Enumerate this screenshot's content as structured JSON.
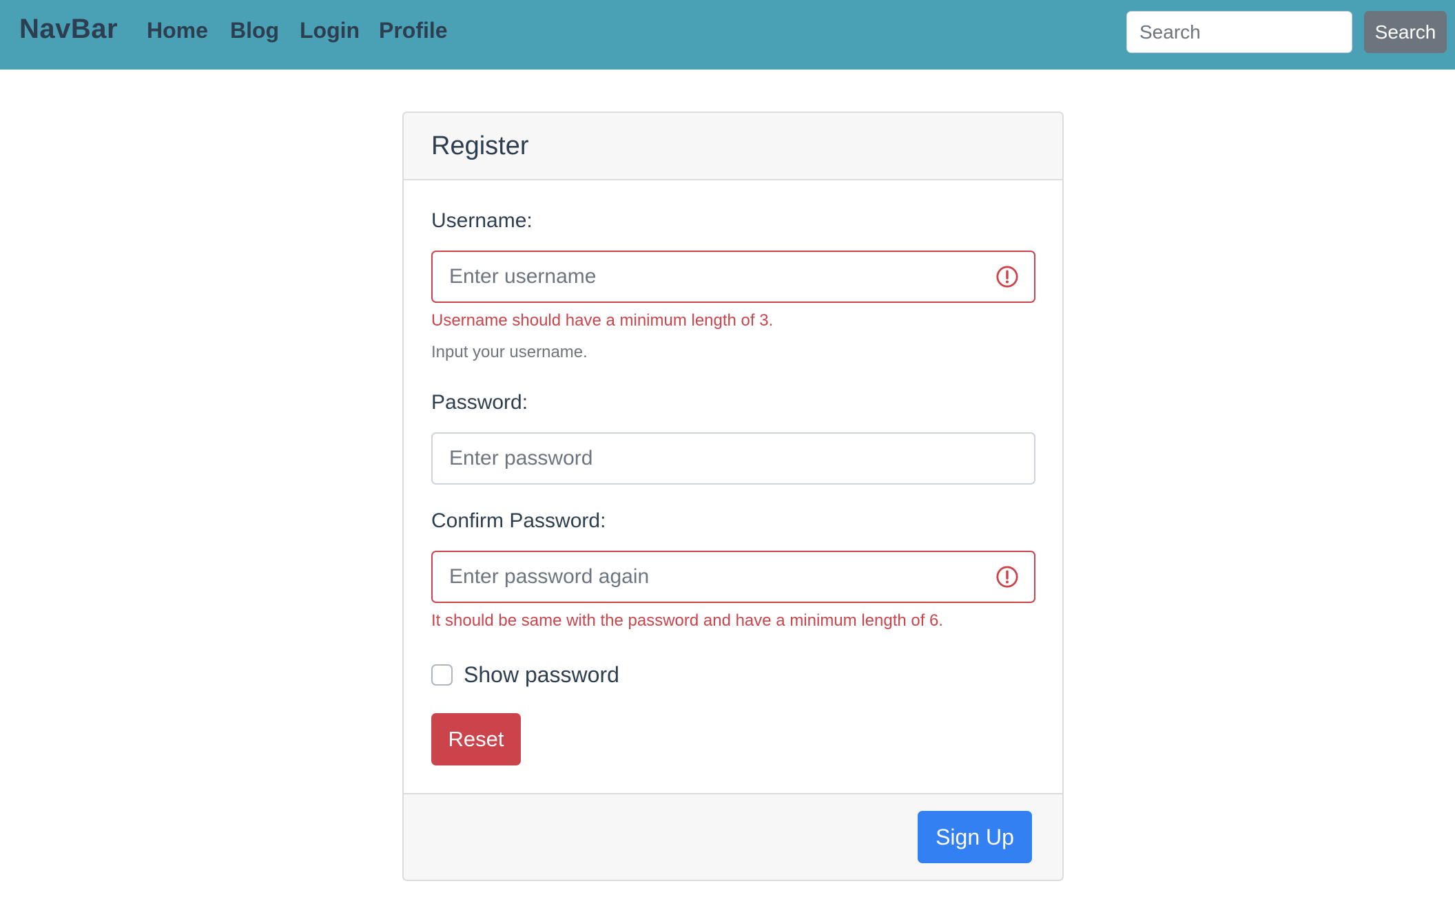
{
  "navbar": {
    "brand": "NavBar",
    "links": [
      {
        "label": "Home"
      },
      {
        "label": "Blog"
      },
      {
        "label": "Login"
      },
      {
        "label": "Profile"
      }
    ],
    "search": {
      "placeholder": "Search",
      "value": "",
      "button_label": "Search"
    }
  },
  "form": {
    "title": "Register",
    "username": {
      "label": "Username:",
      "placeholder": "Enter username",
      "value": "",
      "error": "Username should have a minimum length of 3.",
      "help": "Input your username.",
      "status_icon": "alert-circle-icon"
    },
    "password": {
      "label": "Password:",
      "placeholder": "Enter password",
      "value": ""
    },
    "confirm_password": {
      "label": "Confirm Password:",
      "placeholder": "Enter password again",
      "value": "",
      "error": "It should be same with the password and have a minimum length of 6.",
      "status_icon": "alert-circle-icon"
    },
    "show_password": {
      "label": "Show password",
      "checked": false
    },
    "reset_label": "Reset",
    "signup_label": "Sign Up"
  },
  "colors": {
    "navbar_bg": "#4aa0b5",
    "danger": "#cc444b",
    "primary": "#3380f2",
    "secondary": "#6c757d",
    "text": "#2c3e50"
  }
}
